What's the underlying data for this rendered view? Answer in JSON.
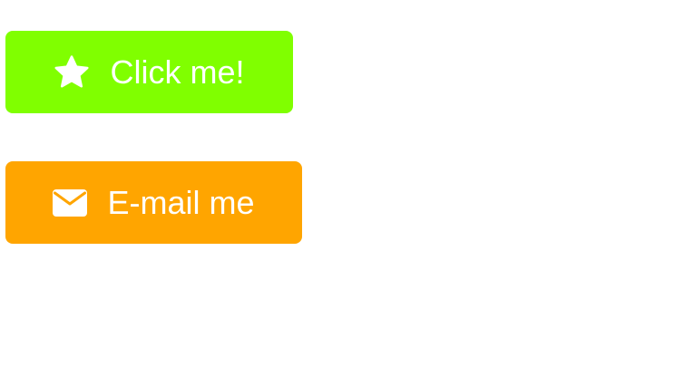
{
  "buttons": {
    "click": {
      "label": "Click me!",
      "icon": "star-icon",
      "color": "#80ff00"
    },
    "email": {
      "label": "E-mail me",
      "icon": "envelope-icon",
      "color": "#ffa500"
    }
  },
  "colors": {
    "text": "#ffffff",
    "background": "#ffffff"
  }
}
